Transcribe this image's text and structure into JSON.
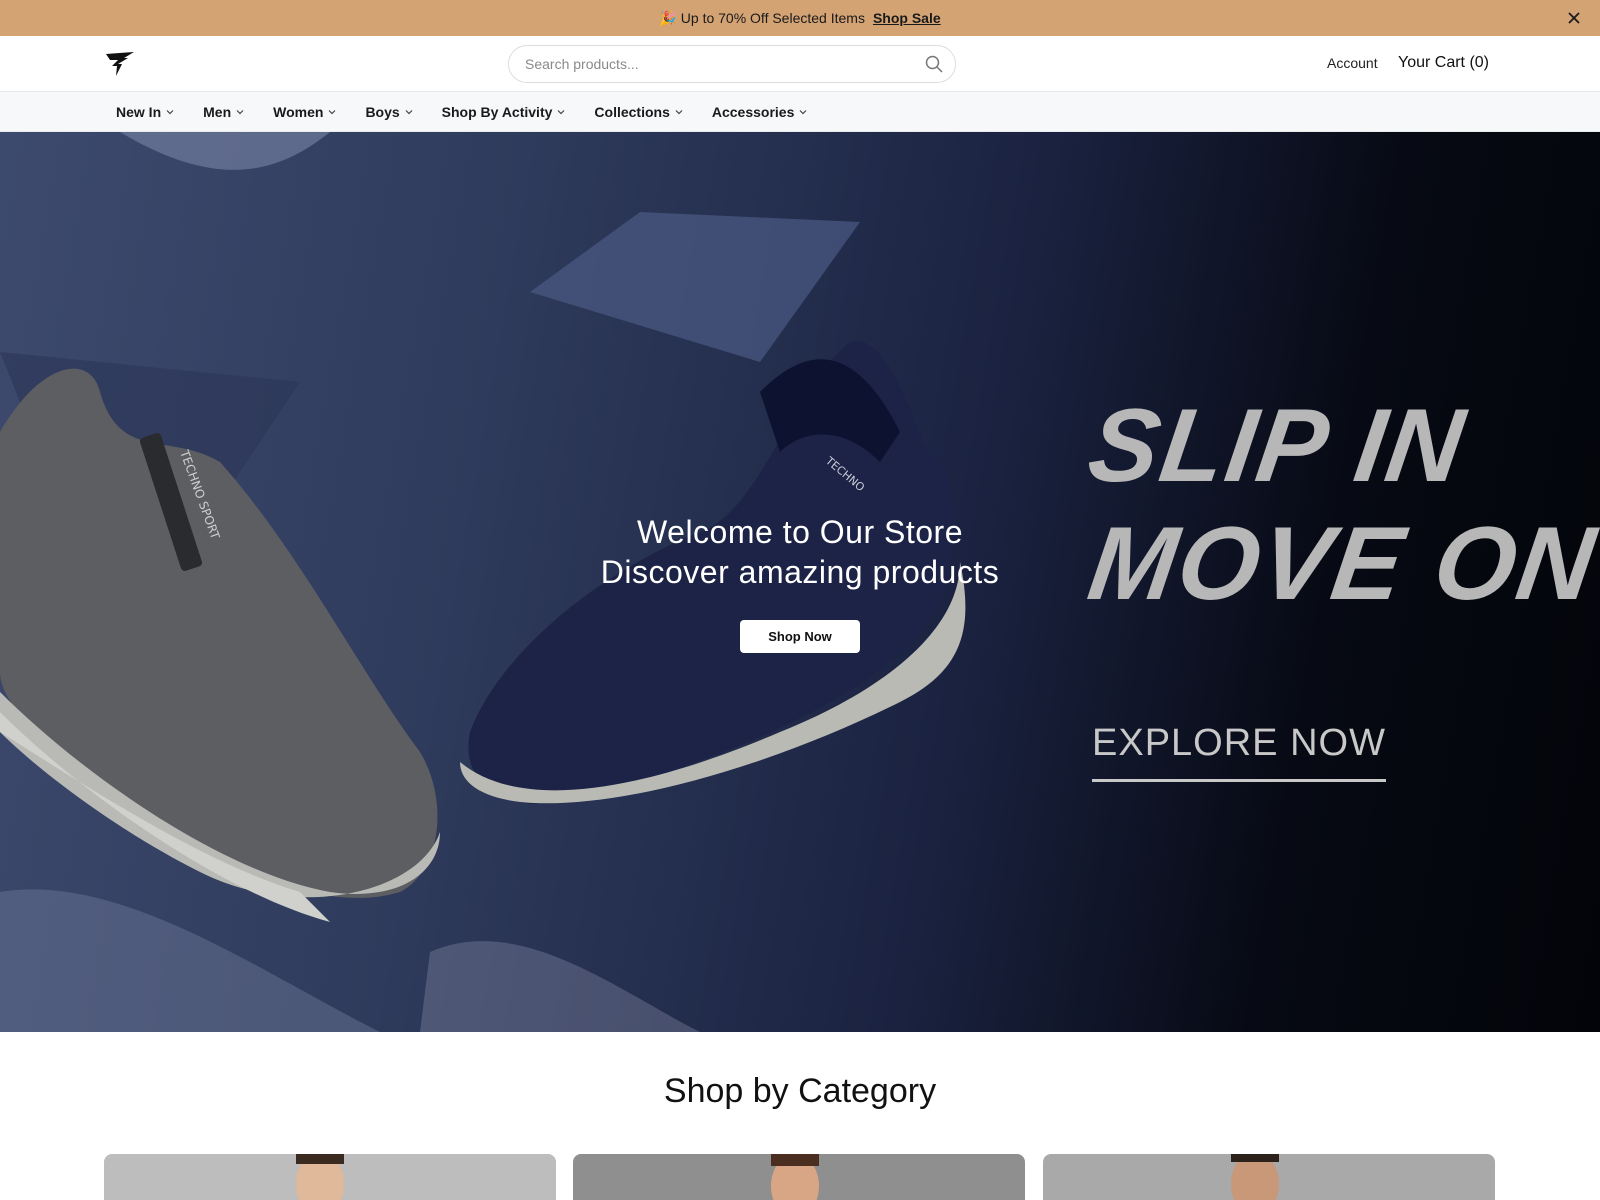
{
  "announcement": {
    "emoji": "🎉",
    "text": "Up to 70% Off Selected Items",
    "link_label": "Shop Sale"
  },
  "header": {
    "search_placeholder": "Search products...",
    "account_label": "Account",
    "cart_label": "Your Cart (0)"
  },
  "nav": {
    "items": [
      {
        "label": "New In"
      },
      {
        "label": "Men"
      },
      {
        "label": "Women"
      },
      {
        "label": "Boys"
      },
      {
        "label": "Shop By Activity"
      },
      {
        "label": "Collections"
      },
      {
        "label": "Accessories"
      }
    ]
  },
  "hero": {
    "title": "Welcome to Our Store",
    "subtitle": "Discover amazing products",
    "cta_label": "Shop Now",
    "promo_line1": "SLIP IN",
    "promo_line2": "MOVE ON",
    "explore_label": "EXPLORE NOW",
    "shoe_brand_text": "TECHNO SPORT",
    "shoe2_brand_text": "TECHNO"
  },
  "categories": {
    "title": "Shop by Category"
  },
  "colors": {
    "announcement_bg": "#d4a373",
    "hero_dark": "#070a14",
    "promo_text": "#b7b7b7"
  },
  "icons": [
    "logo-bird-icon",
    "search-icon",
    "close-icon",
    "chevron-down-icon"
  ]
}
